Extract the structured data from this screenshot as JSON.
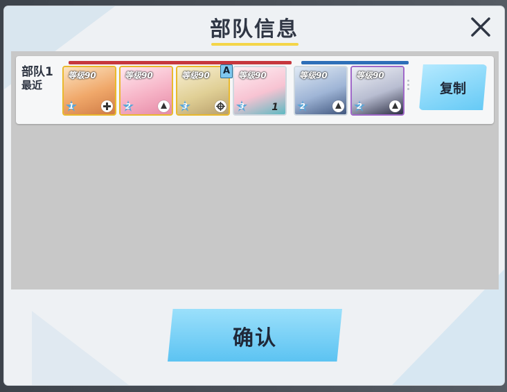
{
  "dialog": {
    "title": "部队信息",
    "confirm_label": "确认"
  },
  "team": {
    "name": "部队1",
    "status": "最近",
    "copy_label": "复制"
  },
  "cards": [
    {
      "level": "等级90",
      "star": "1",
      "role_icon": "heal-icon"
    },
    {
      "level": "等级90",
      "star": "2",
      "role_icon": "support-icon"
    },
    {
      "level": "等级90",
      "star": "3",
      "role_icon": "crosshair-icon",
      "badge": "A"
    },
    {
      "level": "等级90",
      "star": "3",
      "cost": "1"
    },
    {
      "level": "等级90",
      "star": "2",
      "role_icon": "support-icon"
    },
    {
      "level": "等级90",
      "star": "2",
      "role_icon": "support-icon"
    }
  ],
  "colors": {
    "striker_bar": "#c6373d",
    "special_bar": "#2e6fb8",
    "accent_underline": "#f4d548",
    "button_blue": "#64c9f5"
  }
}
